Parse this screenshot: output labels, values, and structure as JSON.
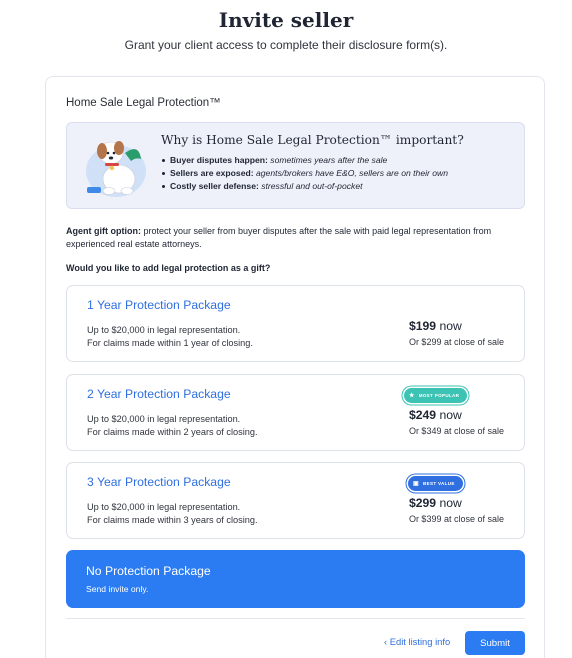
{
  "header": {
    "title": "Invite seller",
    "subtitle": "Grant your client access to complete their disclosure form(s)."
  },
  "section": {
    "title": "Home Sale Legal Protection™"
  },
  "info": {
    "title": "Why is Home Sale Legal Protection™ important?",
    "bullets": [
      {
        "bold": "Buyer disputes happen:",
        "italic": "sometimes years after the sale"
      },
      {
        "bold": "Sellers are exposed:",
        "italic": "agents/brokers have E&O, sellers are on their own"
      },
      {
        "bold": "Costly seller defense:",
        "italic": "stressful and out-of-pocket"
      }
    ],
    "illustration_icon": "dog-illustration-icon"
  },
  "gift": {
    "bold": "Agent gift option:",
    "text": "protect your seller from buyer disputes after the sale with paid legal representation from experienced real estate attorneys.",
    "question": "Would you like to add legal protection as a gift?"
  },
  "packages": [
    {
      "name": "1 Year Protection Package",
      "desc1": "Up to $20,000 in legal representation.",
      "desc2": "For claims made within 1 year of closing.",
      "price": "$199",
      "price_suffix": "now",
      "later": "Or $299 at close of sale",
      "badge": null
    },
    {
      "name": "2 Year Protection Package",
      "desc1": "Up to $20,000 in legal representation.",
      "desc2": "For claims made within 2 years of closing.",
      "price": "$249",
      "price_suffix": "now",
      "later": "Or $349 at close of sale",
      "badge": {
        "label": "Most Popular",
        "icon": "star-icon",
        "color": "#3cc3b4"
      }
    },
    {
      "name": "3 Year Protection Package",
      "desc1": "Up to $20,000 in legal representation.",
      "desc2": "For claims made within 3 years of closing.",
      "price": "$299",
      "price_suffix": "now",
      "later": "Or $399 at close of sale",
      "badge": {
        "label": "Best Value",
        "icon": "value-tag-icon",
        "color": "#2f6fe0"
      }
    }
  ],
  "no_protection": {
    "name": "No Protection Package",
    "desc": "Send invite only.",
    "selected": true,
    "color": "#2b7cf2"
  },
  "footer": {
    "edit_label": "Edit listing info",
    "submit_label": "Submit"
  },
  "colors": {
    "accent": "#2b7cf2",
    "link": "#2f6fe0"
  }
}
